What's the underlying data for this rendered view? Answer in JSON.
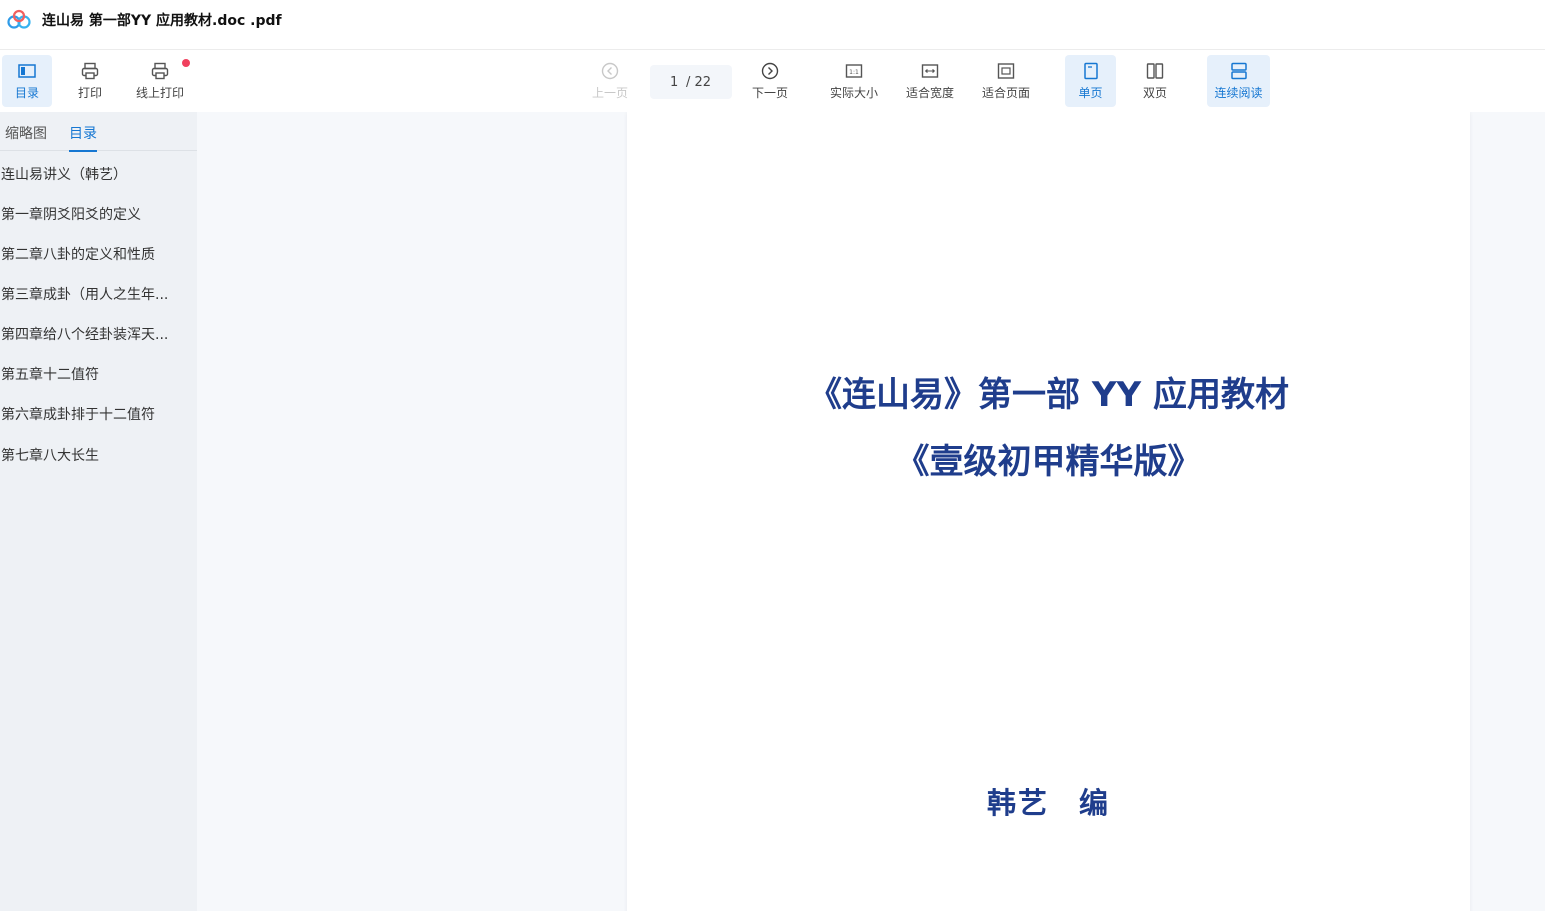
{
  "window": {
    "title": "连山易 第一部YY 应用教材.doc .pdf"
  },
  "toolbar": {
    "toc_label": "目录",
    "print_label": "打印",
    "online_print_label": "线上打印",
    "prev_label": "上一页",
    "current_page": "1",
    "total_pages": "/ 22",
    "next_label": "下一页",
    "actual_size_label": "实际大小",
    "fit_width_label": "适合宽度",
    "fit_page_label": "适合页面",
    "single_label": "单页",
    "double_label": "双页",
    "continuous_label": "连续阅读"
  },
  "sidebar": {
    "tabs": [
      "缩略图",
      "目录"
    ],
    "active_tab": "目录",
    "items": [
      "连山易讲义（韩艺）",
      "第一章阴爻阳爻的定义",
      "第二章八卦的定义和性质",
      "第三章成卦（用人之生年...",
      "第四章给八个经卦装浑天...",
      "第五章十二值符",
      "第六章成卦排于十二值符",
      "第七章八大长生"
    ]
  },
  "document": {
    "line1": "《连山易》第一部 YY 应用教材",
    "line2": "《壹级初甲精华版》",
    "author_name": "韩艺",
    "author_suffix": "编"
  },
  "colors": {
    "accent": "#1677d2",
    "doc_title": "#1f3d8c",
    "badge": "#f0405e"
  }
}
